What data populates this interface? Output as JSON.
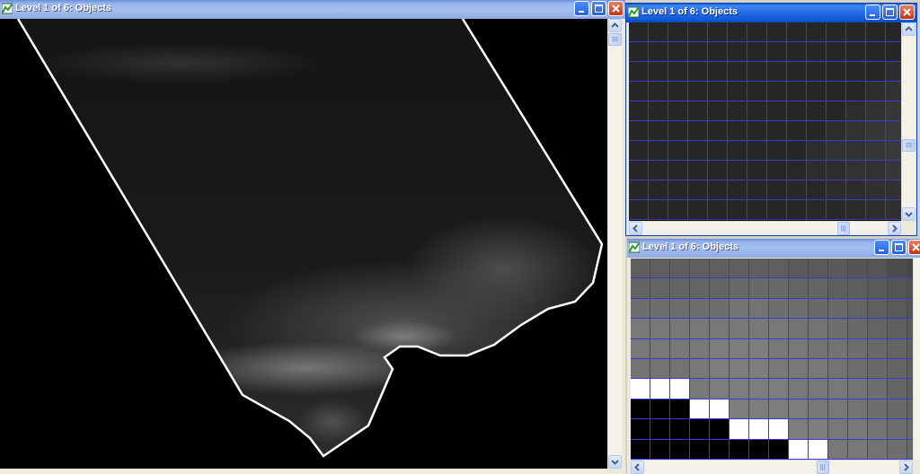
{
  "windows": {
    "main": {
      "title": "Level 1 of 6: Objects"
    },
    "top_right": {
      "title": "Level 1 of 6: Objects"
    },
    "bottom_right": {
      "title": "Level 1 of 6: Objects"
    }
  },
  "icons": {
    "app": "chart-tree-icon",
    "minimize": "minimize-icon",
    "maximize": "maximize-icon",
    "close": "close-icon",
    "scroll_up": "arrow-up-icon",
    "scroll_down": "arrow-down-icon",
    "scroll_left": "arrow-left-icon",
    "scroll_right": "arrow-right-icon"
  },
  "colors": {
    "title_active": "#0f5ad8",
    "title_inactive": "#98b4ec",
    "object_outline": "#ffffff",
    "segment_lines": "#3a3acc"
  },
  "grids": {
    "top": [
      [
        38,
        38,
        38,
        38,
        38,
        38,
        38,
        38,
        38,
        38,
        38,
        38,
        38,
        38
      ],
      [
        38,
        38,
        38,
        38,
        38,
        38,
        38,
        38,
        38,
        38,
        38,
        38,
        38,
        38
      ],
      [
        38,
        38,
        38,
        38,
        38,
        38,
        38,
        38,
        38,
        38,
        38,
        38,
        38,
        45
      ],
      [
        38,
        38,
        38,
        38,
        38,
        38,
        38,
        38,
        38,
        38,
        38,
        38,
        45,
        50
      ],
      [
        38,
        38,
        38,
        38,
        38,
        38,
        38,
        38,
        38,
        38,
        38,
        45,
        50,
        55
      ],
      [
        38,
        38,
        38,
        38,
        38,
        38,
        38,
        38,
        38,
        38,
        45,
        50,
        55,
        58
      ],
      [
        38,
        38,
        38,
        38,
        38,
        38,
        38,
        38,
        38,
        45,
        50,
        50,
        55,
        58
      ],
      [
        38,
        38,
        38,
        38,
        38,
        38,
        38,
        38,
        40,
        45,
        45,
        50,
        50,
        55
      ],
      [
        38,
        38,
        38,
        38,
        38,
        38,
        38,
        38,
        40,
        40,
        45,
        45,
        48,
        50
      ],
      [
        38,
        38,
        38,
        38,
        38,
        38,
        38,
        38,
        38,
        40,
        40,
        42,
        45,
        48
      ]
    ],
    "bottom": [
      [
        95,
        95,
        95,
        95,
        95,
        95,
        95,
        95,
        90,
        90,
        90,
        85,
        85,
        75,
        70
      ],
      [
        100,
        100,
        100,
        100,
        100,
        105,
        105,
        105,
        100,
        100,
        95,
        95,
        90,
        85,
        80
      ],
      [
        110,
        110,
        110,
        110,
        110,
        115,
        115,
        110,
        110,
        105,
        105,
        100,
        95,
        90,
        85
      ],
      [
        120,
        120,
        120,
        120,
        120,
        120,
        120,
        120,
        115,
        115,
        110,
        105,
        100,
        95,
        90
      ],
      [
        120,
        120,
        120,
        120,
        125,
        125,
        125,
        120,
        120,
        115,
        115,
        110,
        105,
        100,
        95
      ],
      [
        115,
        115,
        115,
        120,
        125,
        125,
        125,
        120,
        120,
        120,
        115,
        110,
        105,
        100,
        95
      ],
      [
        255,
        255,
        255,
        120,
        125,
        125,
        125,
        125,
        120,
        120,
        120,
        115,
        110,
        100,
        95
      ],
      [
        0,
        0,
        0,
        255,
        255,
        125,
        125,
        125,
        125,
        120,
        120,
        115,
        110,
        105,
        100
      ],
      [
        0,
        0,
        0,
        0,
        0,
        255,
        255,
        255,
        125,
        125,
        120,
        120,
        115,
        110,
        105
      ],
      [
        0,
        0,
        0,
        0,
        0,
        0,
        0,
        0,
        255,
        255,
        120,
        120,
        115,
        110,
        105
      ]
    ]
  }
}
